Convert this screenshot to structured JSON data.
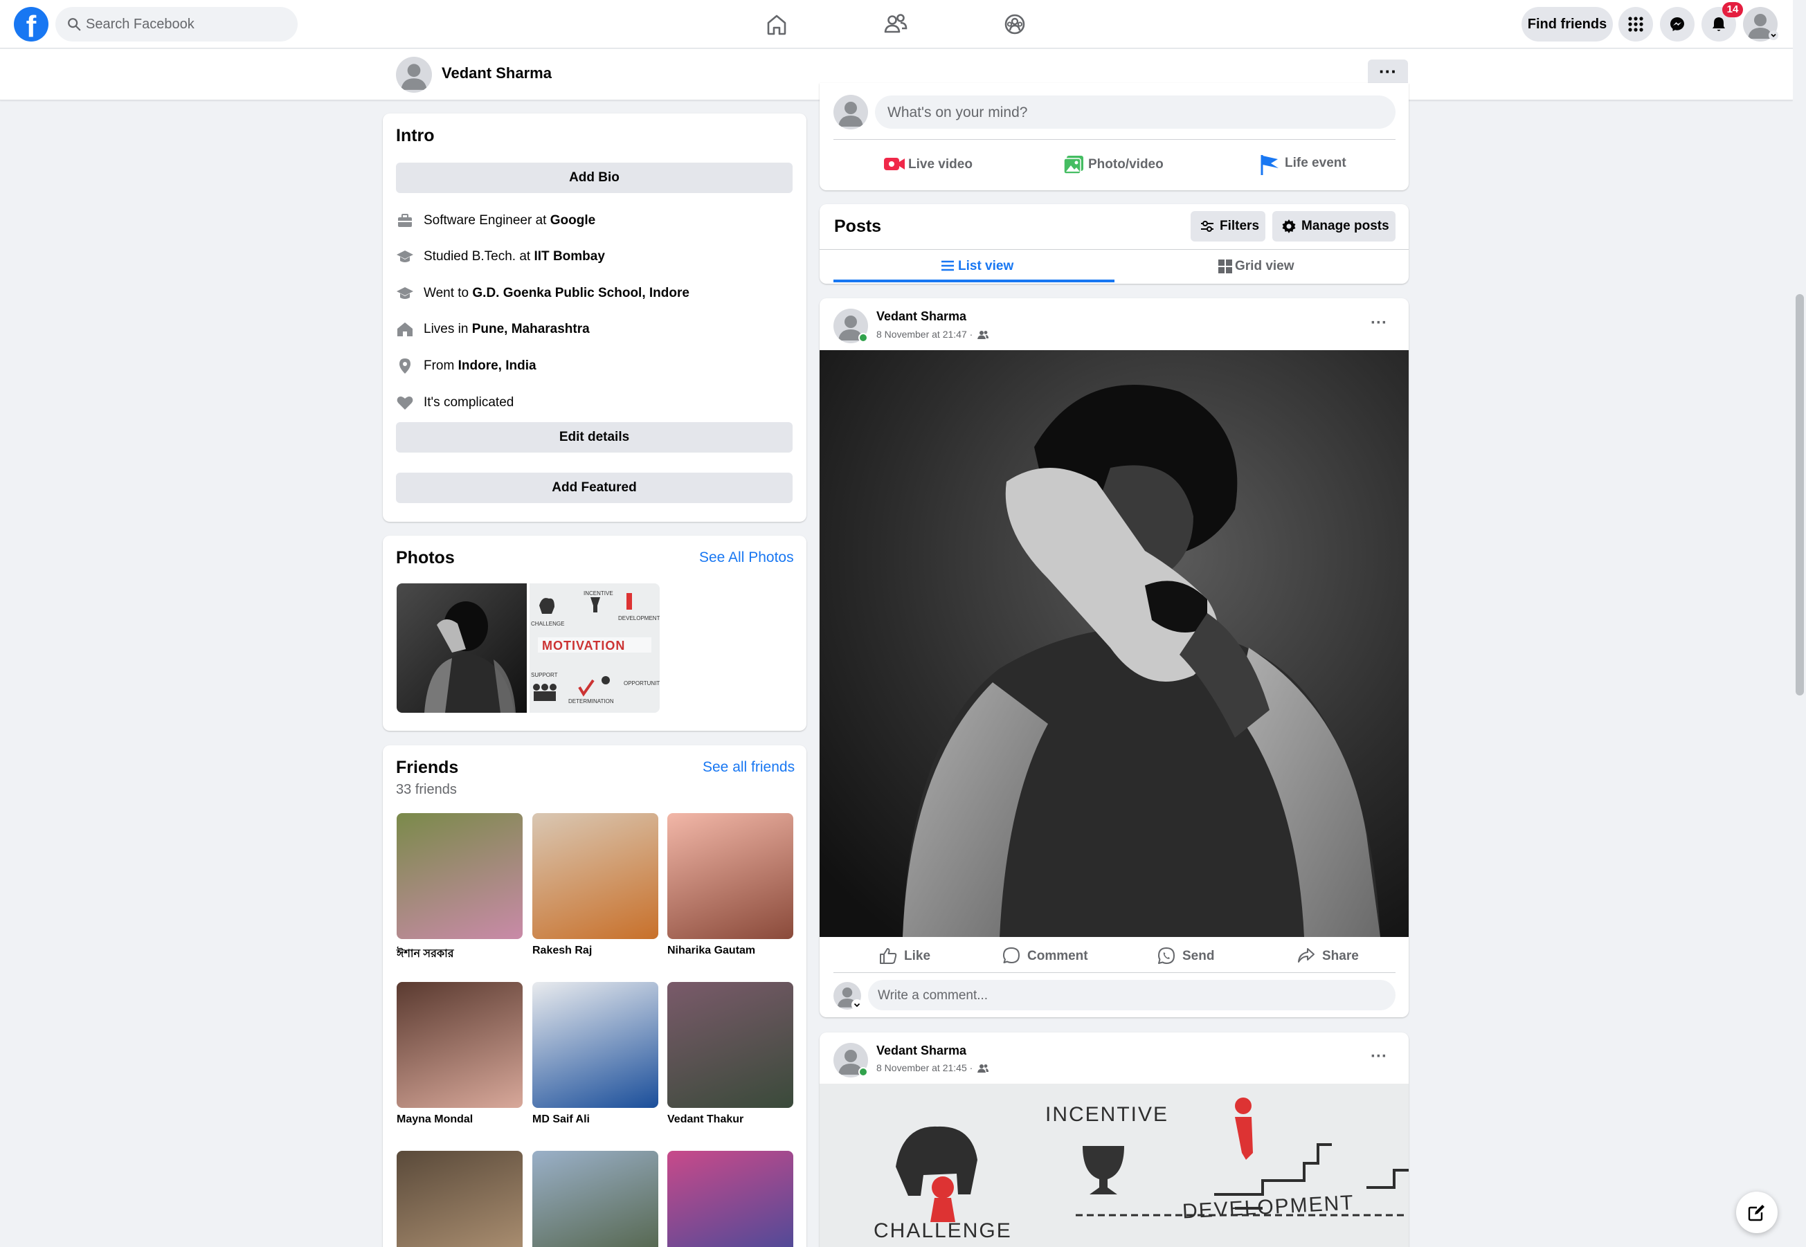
{
  "topnav": {
    "logo": "f",
    "search_placeholder": "Search Facebook",
    "find_friends": "Find friends",
    "notification_count": "14"
  },
  "profile_bar": {
    "name": "Vedant Sharma",
    "more": "···"
  },
  "intro": {
    "title": "Intro",
    "add_bio": "Add Bio",
    "rows": [
      {
        "prefix": "Software Engineer at ",
        "bold": "Google",
        "icon": "briefcase-icon"
      },
      {
        "prefix": "Studied B.Tech. at ",
        "bold": "IIT Bombay",
        "icon": "graduation-cap-icon"
      },
      {
        "prefix": "Went to ",
        "bold": "G.D. Goenka Public School, Indore",
        "icon": "graduation-cap-icon"
      },
      {
        "prefix": "Lives in ",
        "bold": "Pune, Maharashtra",
        "icon": "home-icon"
      },
      {
        "prefix": "From ",
        "bold": "Indore, India",
        "icon": "location-pin-icon"
      },
      {
        "prefix": "It's complicated",
        "bold": "",
        "icon": "heart-icon"
      }
    ],
    "edit_details": "Edit details",
    "add_featured": "Add Featured"
  },
  "photos": {
    "title": "Photos",
    "see_all": "See All Photos",
    "motivation_words": [
      "INCENTIVE",
      "CHALLENGE",
      "DEVELOPMENT",
      "MOTIVATION",
      "SUPPORT",
      "DETERMINATION",
      "OPPORTUNITY"
    ]
  },
  "friends": {
    "title": "Friends",
    "count": "33 friends",
    "see_all": "See all friends",
    "list": [
      {
        "name": "ঈশান সরকার",
        "color1": "#7a8a4a",
        "color2": "#c98aa8"
      },
      {
        "name": "Rakesh Raj",
        "color1": "#d9c7b3",
        "color2": "#c8702a"
      },
      {
        "name": "Niharika Gautam",
        "color1": "#f2b7a8",
        "color2": "#8a4a3a"
      },
      {
        "name": "Mayna Mondal",
        "color1": "#5a3a30",
        "color2": "#d8a89a"
      },
      {
        "name": "MD Saif Ali",
        "color1": "#e9ebee",
        "color2": "#1a4e9a"
      },
      {
        "name": "Vedant Thakur",
        "color1": "#7a5a6a",
        "color2": "#3a4a3a"
      },
      {
        "name": "",
        "color1": "#5a4a3a",
        "color2": "#b89a7a"
      },
      {
        "name": "",
        "color1": "#9ab0c8",
        "color2": "#4a5a3a"
      },
      {
        "name": "",
        "color1": "#c84a8a",
        "color2": "#3a4a9a"
      }
    ]
  },
  "composer": {
    "placeholder": "What's on your mind?",
    "live_video": "Live video",
    "photo_video": "Photo/video",
    "life_event": "Life event"
  },
  "posts_section": {
    "title": "Posts",
    "filters": "Filters",
    "manage_posts": "Manage posts",
    "list_view": "List view",
    "grid_view": "Grid view"
  },
  "posts": [
    {
      "author": "Vedant Sharma",
      "time": "8 November at 21:47 ·",
      "actions": {
        "like": "Like",
        "comment": "Comment",
        "send": "Send",
        "share": "Share"
      },
      "comment_placeholder": "Write a comment..."
    },
    {
      "author": "Vedant Sharma",
      "time": "8 November at 21:45 ·",
      "image_words": [
        "INCENTIVE",
        "DEVELOPMENT",
        "CHALLENGE"
      ]
    }
  ]
}
